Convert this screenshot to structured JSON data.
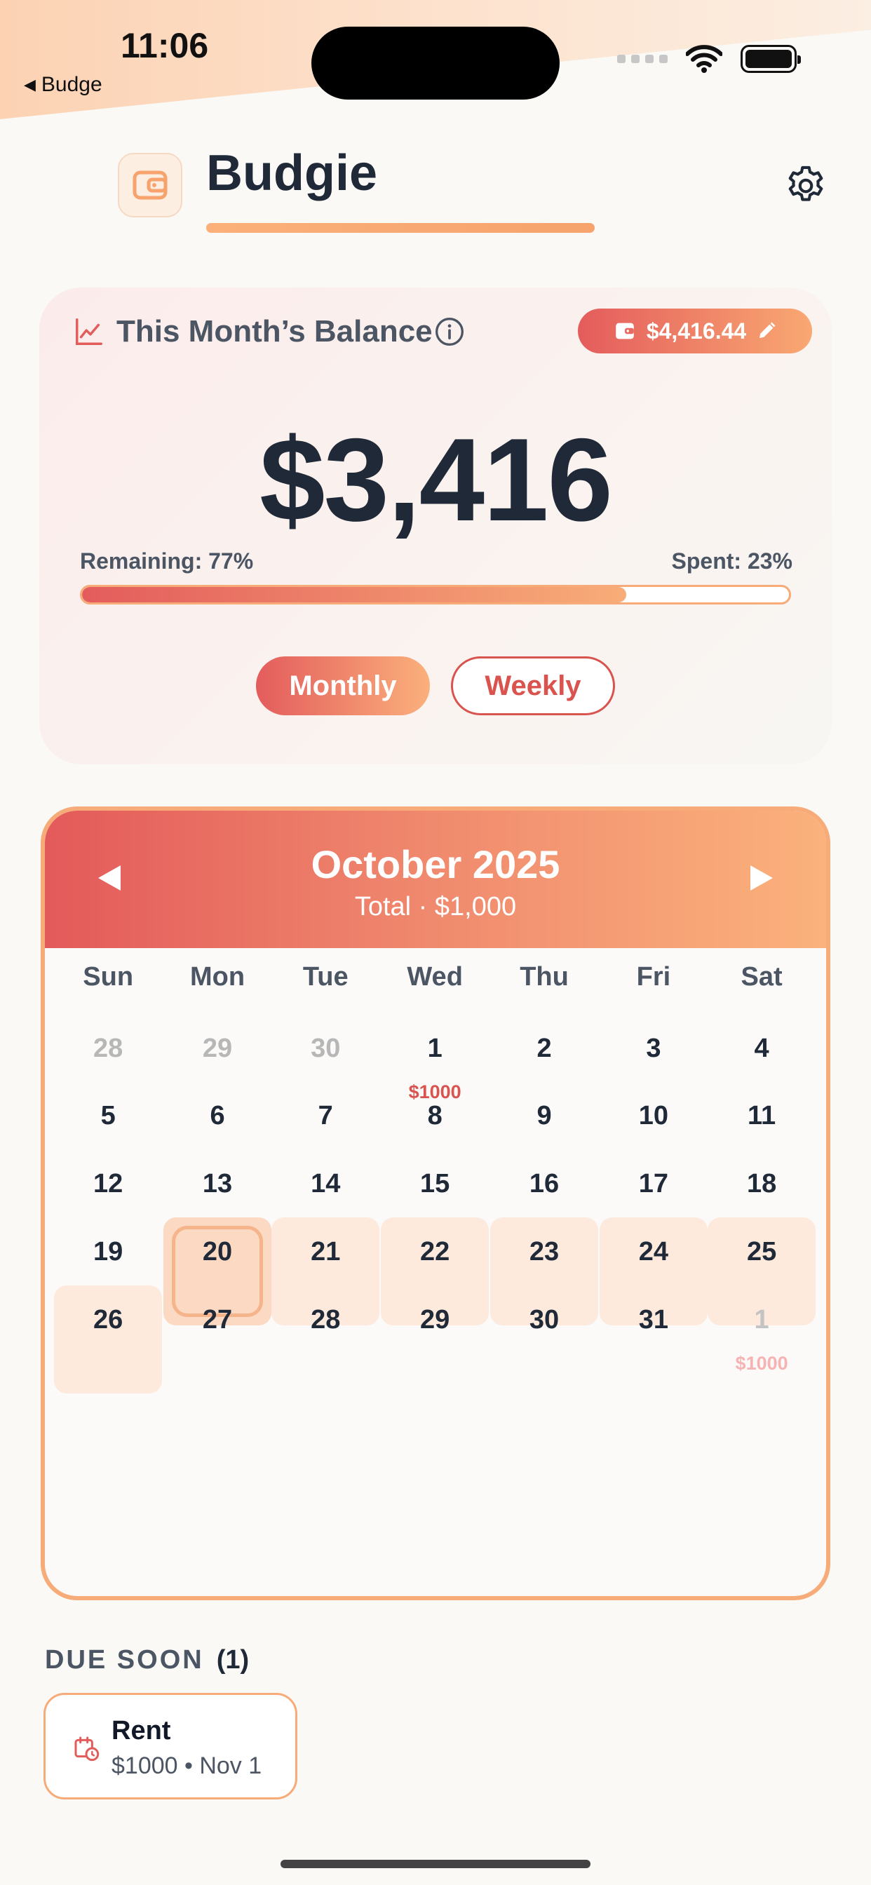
{
  "status": {
    "time": "11:06",
    "back_label": "Budge",
    "wifi_icon": "wifi-icon",
    "battery_icon": "battery-icon"
  },
  "header": {
    "app_name": "Budgie",
    "logo_icon": "wallet-icon",
    "settings_icon": "gear-icon",
    "accent_color": "#f6a36d"
  },
  "balance": {
    "title": "This Month’s Balance",
    "total_budget": "$4,416.44",
    "amount": "$3,416",
    "remaining_label": "Remaining: 77%",
    "spent_label": "Spent: 23%",
    "remaining_fraction": 0.77,
    "periods": {
      "monthly": "Monthly",
      "weekly": "Weekly",
      "selected": "Monthly"
    }
  },
  "calendar": {
    "month": "October 2025",
    "total": "Total · $1,000",
    "weekdays": [
      "Sun",
      "Mon",
      "Tue",
      "Wed",
      "Thu",
      "Fri",
      "Sat"
    ],
    "weeks": [
      [
        {
          "d": "28",
          "muted": true
        },
        {
          "d": "29",
          "muted": true
        },
        {
          "d": "30",
          "muted": true
        },
        {
          "d": "1",
          "amt": "$1000"
        },
        {
          "d": "2"
        },
        {
          "d": "3"
        },
        {
          "d": "4"
        }
      ],
      [
        {
          "d": "5"
        },
        {
          "d": "6"
        },
        {
          "d": "7"
        },
        {
          "d": "8"
        },
        {
          "d": "9"
        },
        {
          "d": "10"
        },
        {
          "d": "11"
        }
      ],
      [
        {
          "d": "12"
        },
        {
          "d": "13"
        },
        {
          "d": "14"
        },
        {
          "d": "15"
        },
        {
          "d": "16"
        },
        {
          "d": "17"
        },
        {
          "d": "18"
        }
      ],
      [
        {
          "d": "19"
        },
        {
          "d": "20",
          "today": true
        },
        {
          "d": "21",
          "week": true
        },
        {
          "d": "22",
          "week": true
        },
        {
          "d": "23",
          "week": true
        },
        {
          "d": "24",
          "week": true
        },
        {
          "d": "25",
          "week": true
        }
      ],
      [
        {
          "d": "26",
          "week": true
        },
        {
          "d": "27"
        },
        {
          "d": "28"
        },
        {
          "d": "29"
        },
        {
          "d": "30"
        },
        {
          "d": "31"
        },
        {
          "d": "1",
          "next": true,
          "amt": "$1000"
        }
      ]
    ],
    "prev_icon": "triangle-left-icon",
    "next_icon": "triangle-right-icon"
  },
  "due_soon": {
    "title": "DUE SOON",
    "count": "(1)",
    "items": [
      {
        "name": "Rent",
        "meta": "$1000 • Nov 1",
        "icon": "calendar-clock-icon"
      }
    ]
  }
}
